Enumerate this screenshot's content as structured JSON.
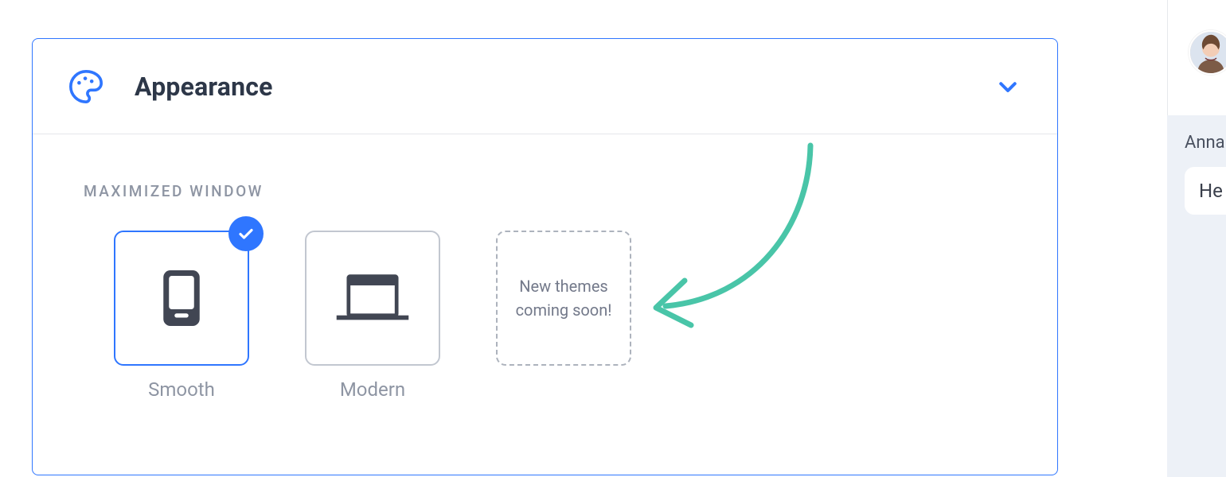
{
  "card": {
    "title": "Appearance",
    "section_label": "MAXIMIZED WINDOW"
  },
  "themes": {
    "smooth": {
      "label": "Smooth",
      "selected": true
    },
    "modern": {
      "label": "Modern",
      "selected": false
    },
    "placeholder_text": "New themes coming soon!"
  },
  "preview": {
    "name": "Anna",
    "msg": "He"
  }
}
